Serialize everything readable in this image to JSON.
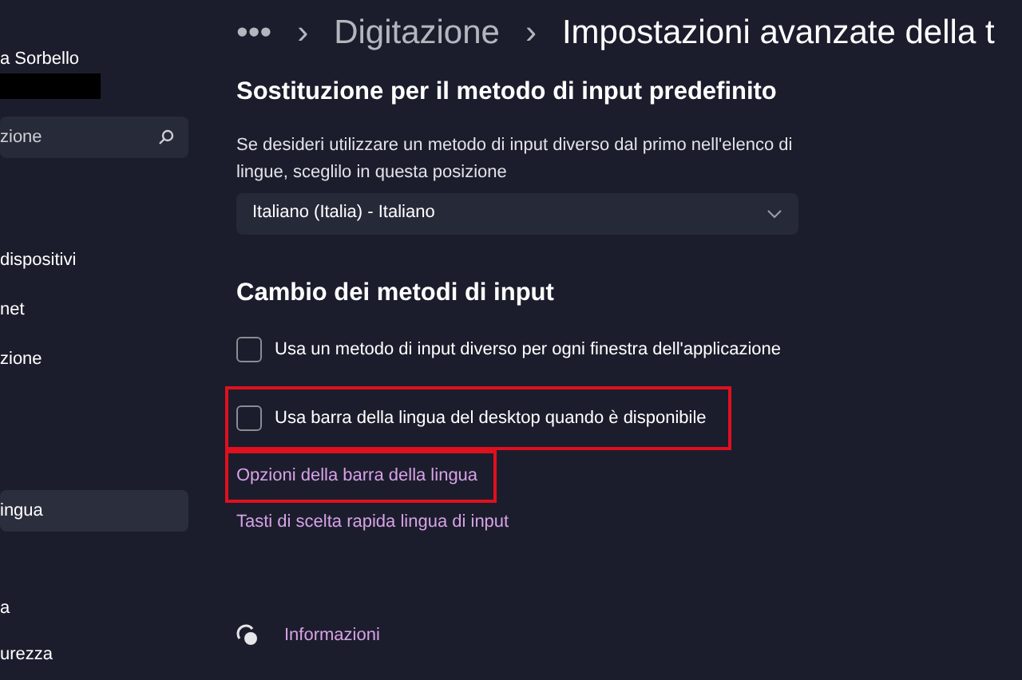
{
  "sidebar": {
    "user_name": "a Sorbello",
    "search": {
      "placeholder": "zione"
    },
    "items": [
      {
        "label": "dispositivi",
        "selected": false
      },
      {
        "label": "net",
        "selected": false
      },
      {
        "label": "zione",
        "selected": false
      },
      {
        "label": "ingua",
        "selected": true
      },
      {
        "label": "a",
        "selected": false
      },
      {
        "label": "urezza",
        "selected": false
      }
    ]
  },
  "breadcrumb": {
    "ellipsis": "•••",
    "separator": "›",
    "items": [
      {
        "label": "Digitazione",
        "current": false
      },
      {
        "label": "Impostazioni avanzate della t",
        "current": true
      }
    ]
  },
  "sections": [
    {
      "heading": "Sostituzione per il metodo di input predefinito",
      "description": "Se desideri utilizzare un metodo di input diverso dal primo nell'elenco di lingue, sceglilo in questa posizione",
      "dropdown": {
        "value": "Italiano (Italia) - Italiano"
      }
    },
    {
      "heading": "Cambio dei metodi di input",
      "items": [
        {
          "kind": "checkbox",
          "label": "Usa un metodo di input diverso per ogni finestra dell'applicazione",
          "checked": false,
          "highlighted": false
        },
        {
          "kind": "checkbox",
          "label": "Usa barra della lingua del desktop quando è disponibile",
          "checked": false,
          "highlighted": true
        },
        {
          "kind": "link",
          "label": "Opzioni della barra della lingua",
          "highlighted": true
        },
        {
          "kind": "link",
          "label": "Tasti di scelta rapida lingua di input",
          "highlighted": false
        }
      ]
    }
  ],
  "help_link": "Informazioni"
}
